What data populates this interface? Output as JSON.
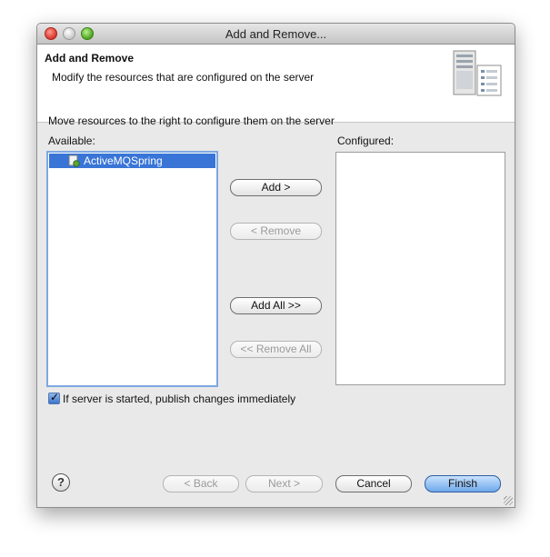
{
  "window": {
    "title": "Add and Remove..."
  },
  "header": {
    "title": "Add and Remove",
    "description": "Modify the resources that are configured on the server"
  },
  "instructions": "Move resources to the right to configure them on the server",
  "available": {
    "label": "Available:",
    "items": [
      {
        "label": "ActiveMQSpring",
        "selected": true
      }
    ]
  },
  "configured": {
    "label": "Configured:",
    "items": []
  },
  "buttons": {
    "add": "Add >",
    "remove": "< Remove",
    "add_all": "Add All >>",
    "remove_all": "<< Remove All"
  },
  "publish_checkbox": {
    "label": "If server is started, publish changes immediately",
    "checked": true
  },
  "footer": {
    "help": "?",
    "back": "< Back",
    "next": "Next >",
    "cancel": "Cancel",
    "finish": "Finish"
  },
  "colors": {
    "selection": "#3875d7",
    "focus_border": "#7ea8e0",
    "default_button": "#6fa8ea"
  }
}
